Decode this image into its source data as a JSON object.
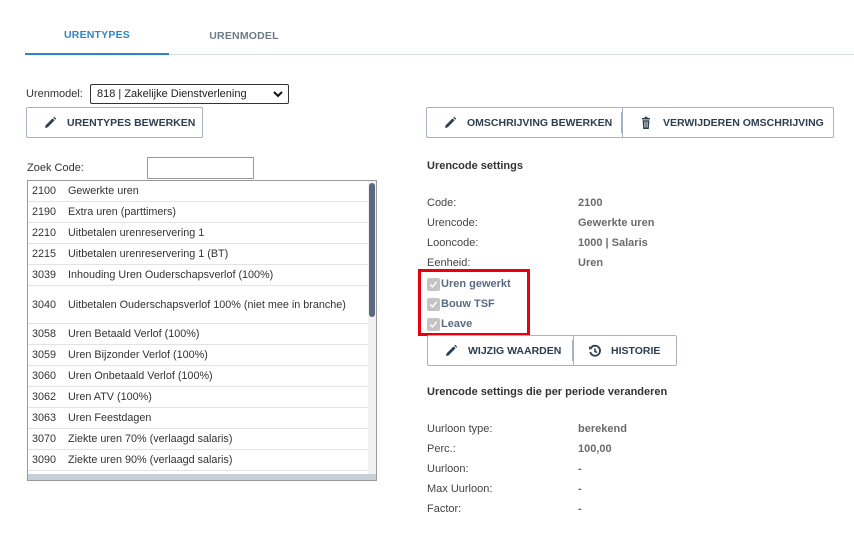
{
  "tabs": [
    {
      "label": "URENTYPES",
      "active": true
    },
    {
      "label": "URENMODEL",
      "active": false
    }
  ],
  "urenmodel": {
    "label": "Urenmodel:",
    "selected": "818 | Zakelijke Dienstverlening"
  },
  "buttons": {
    "urentypes_bewerken": "URENTYPES BEWERKEN",
    "omschrijving_bewerken": "OMSCHRIJVING BEWERKEN",
    "verwijderen_omschrijving": "VERWIJDEREN OMSCHRIJVING",
    "wijzig_waarden": "WIJZIG WAARDEN",
    "historie": "HISTORIE"
  },
  "search": {
    "label": "Zoek Code:",
    "value": ""
  },
  "codes": [
    {
      "code": "2100",
      "desc": "Gewerkte uren"
    },
    {
      "code": "2190",
      "desc": "Extra uren (parttimers)"
    },
    {
      "code": "2210",
      "desc": "Uitbetalen urenreservering 1"
    },
    {
      "code": "2215",
      "desc": "Uitbetalen urenreservering 1 (BT)"
    },
    {
      "code": "3039",
      "desc": "Inhouding Uren Ouderschapsverlof (100%)"
    },
    {
      "code": "3040",
      "desc": "Uitbetalen Ouderschapsverlof 100% (niet mee in branche)"
    },
    {
      "code": "3058",
      "desc": "Uren Betaald Verlof (100%)"
    },
    {
      "code": "3059",
      "desc": "Uren Bijzonder Verlof (100%)"
    },
    {
      "code": "3060",
      "desc": "Uren Onbetaald Verlof (100%)"
    },
    {
      "code": "3062",
      "desc": "Uren ATV (100%)"
    },
    {
      "code": "3063",
      "desc": "Uren Feestdagen"
    },
    {
      "code": "3070",
      "desc": "Ziekte uren 70% (verlaagd salaris)"
    },
    {
      "code": "3090",
      "desc": "Ziekte uren 90% (verlaagd salaris)"
    }
  ],
  "settings": {
    "title": "Urencode settings",
    "rows": [
      {
        "key": "Code:",
        "value": "2100"
      },
      {
        "key": "Urencode:",
        "value": "Gewerkte uren"
      },
      {
        "key": "Looncode:",
        "value": "1000 | Salaris"
      },
      {
        "key": "Eenheid:",
        "value": "Uren"
      }
    ],
    "checks": [
      {
        "label": "Uren gewerkt",
        "checked": true
      },
      {
        "label": "Bouw TSF",
        "checked": true
      },
      {
        "label": "Leave",
        "checked": true
      }
    ]
  },
  "periode": {
    "title": "Urencode settings die per periode veranderen",
    "rows": [
      {
        "key": "Uurloon type:",
        "value": "berekend"
      },
      {
        "key": "Perc.:",
        "value": "100,00"
      },
      {
        "key": "Uurloon:",
        "value": "-"
      },
      {
        "key": "Max Uurloon:",
        "value": "-"
      },
      {
        "key": "Factor:",
        "value": "-"
      }
    ]
  },
  "colors": {
    "accent": "#2e86c9",
    "highlight_box": "#e8000f"
  },
  "icons": {
    "pencil": "pencil-icon",
    "trash": "trash-icon",
    "history": "history-icon",
    "chevron": "chevron-down-icon"
  }
}
